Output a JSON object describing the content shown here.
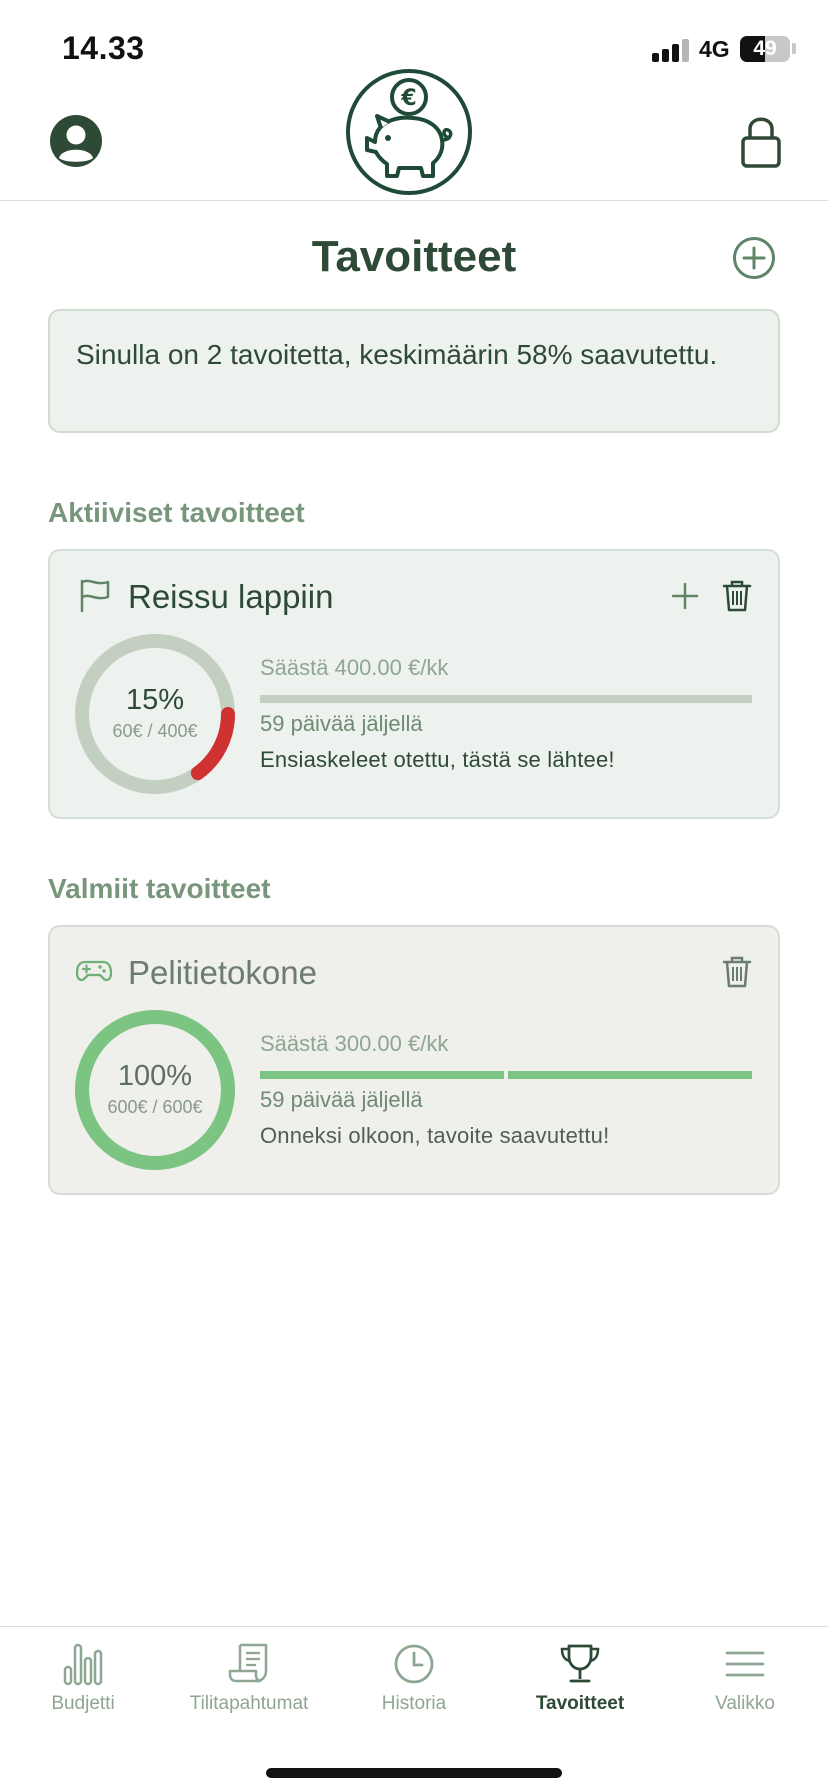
{
  "status_bar": {
    "time": "14.33",
    "network": "4G",
    "battery": "49",
    "battery_level": 0.49
  },
  "header": {
    "avatar_icon": "user-circle-icon",
    "logo_icon": "piggy-bank-euro-icon",
    "lock_icon": "lock-icon"
  },
  "page": {
    "title": "Tavoitteet",
    "add_icon": "plus-circle-icon"
  },
  "summary": {
    "text": "Sinulla on 2 tavoitetta, keskimäärin 58% saavutettu."
  },
  "sections": {
    "active_label": "Aktiiviset tavoitteet",
    "done_label": "Valmiit tavoitteet"
  },
  "goals": {
    "active": [
      {
        "name": "Reissu lappiin",
        "icon": "flag-icon",
        "percent_label": "15%",
        "amount_label": "60€ / 400€",
        "progress": 0.15,
        "save_rate": "Säästä 400.00 €/kk",
        "days_left": "59 päivää jäljellä",
        "message": "Ensiaskeleet otettu, tästä se lähtee!",
        "ring_color": "#d03131",
        "track_color": "#c2cfc1"
      }
    ],
    "done": [
      {
        "name": "Pelitietokone",
        "icon": "gamepad-icon",
        "percent_label": "100%",
        "amount_label": "600€ / 600€",
        "progress": 1.0,
        "save_rate": "Säästä 300.00 €/kk",
        "days_left": "59 päivää jäljellä",
        "message": "Onneksi olkoon, tavoite saavutettu!",
        "ring_color": "#7cc482",
        "track_color": "#c2cfc1"
      }
    ]
  },
  "tabs": [
    {
      "label": "Budjetti",
      "icon": "bar-chart-icon",
      "active": false
    },
    {
      "label": "Tilitapahtumat",
      "icon": "receipt-icon",
      "active": false
    },
    {
      "label": "Historia",
      "icon": "clock-icon",
      "active": false
    },
    {
      "label": "Tavoitteet",
      "icon": "trophy-icon",
      "active": true
    },
    {
      "label": "Valikko",
      "icon": "menu-icon",
      "active": false
    }
  ],
  "colors": {
    "brand_dark": "#2e4a37",
    "muted_green": "#78967c",
    "card_bg": "#eef2ee",
    "danger": "#d03131",
    "success": "#7cc482"
  }
}
